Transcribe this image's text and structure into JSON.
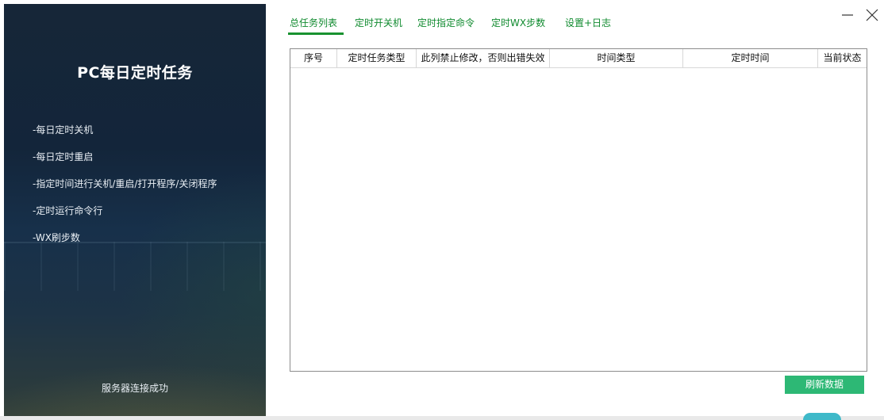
{
  "app": {
    "title": "PC每日定时任务",
    "features": [
      "-每日定时关机",
      "-每日定时重启",
      "-指定时间进行关机/重启/打开程序/关闭程序",
      "-定时运行命令行",
      "-WX刷步数"
    ],
    "server_status": "服务器连接成功"
  },
  "tabs": [
    {
      "label": "总任务列表",
      "active": true
    },
    {
      "label": "定时开关机",
      "active": false
    },
    {
      "label": "定时指定命令",
      "active": false
    },
    {
      "label": "定时WX步数",
      "active": false
    },
    {
      "label": "设置+日志",
      "active": false
    }
  ],
  "table": {
    "columns": [
      "序号",
      "定时任务类型",
      "此列禁止修改，否则出错失效",
      "时间类型",
      "定时时间",
      "当前状态"
    ],
    "rows": []
  },
  "actions": {
    "refresh_label": "刷新数据"
  },
  "window_controls": {
    "minimize_icon": "minimize-icon",
    "close_icon": "close-icon"
  },
  "colors": {
    "accent_green": "#18922f",
    "button_green": "#2db875",
    "panel_dark": "#13253a"
  }
}
